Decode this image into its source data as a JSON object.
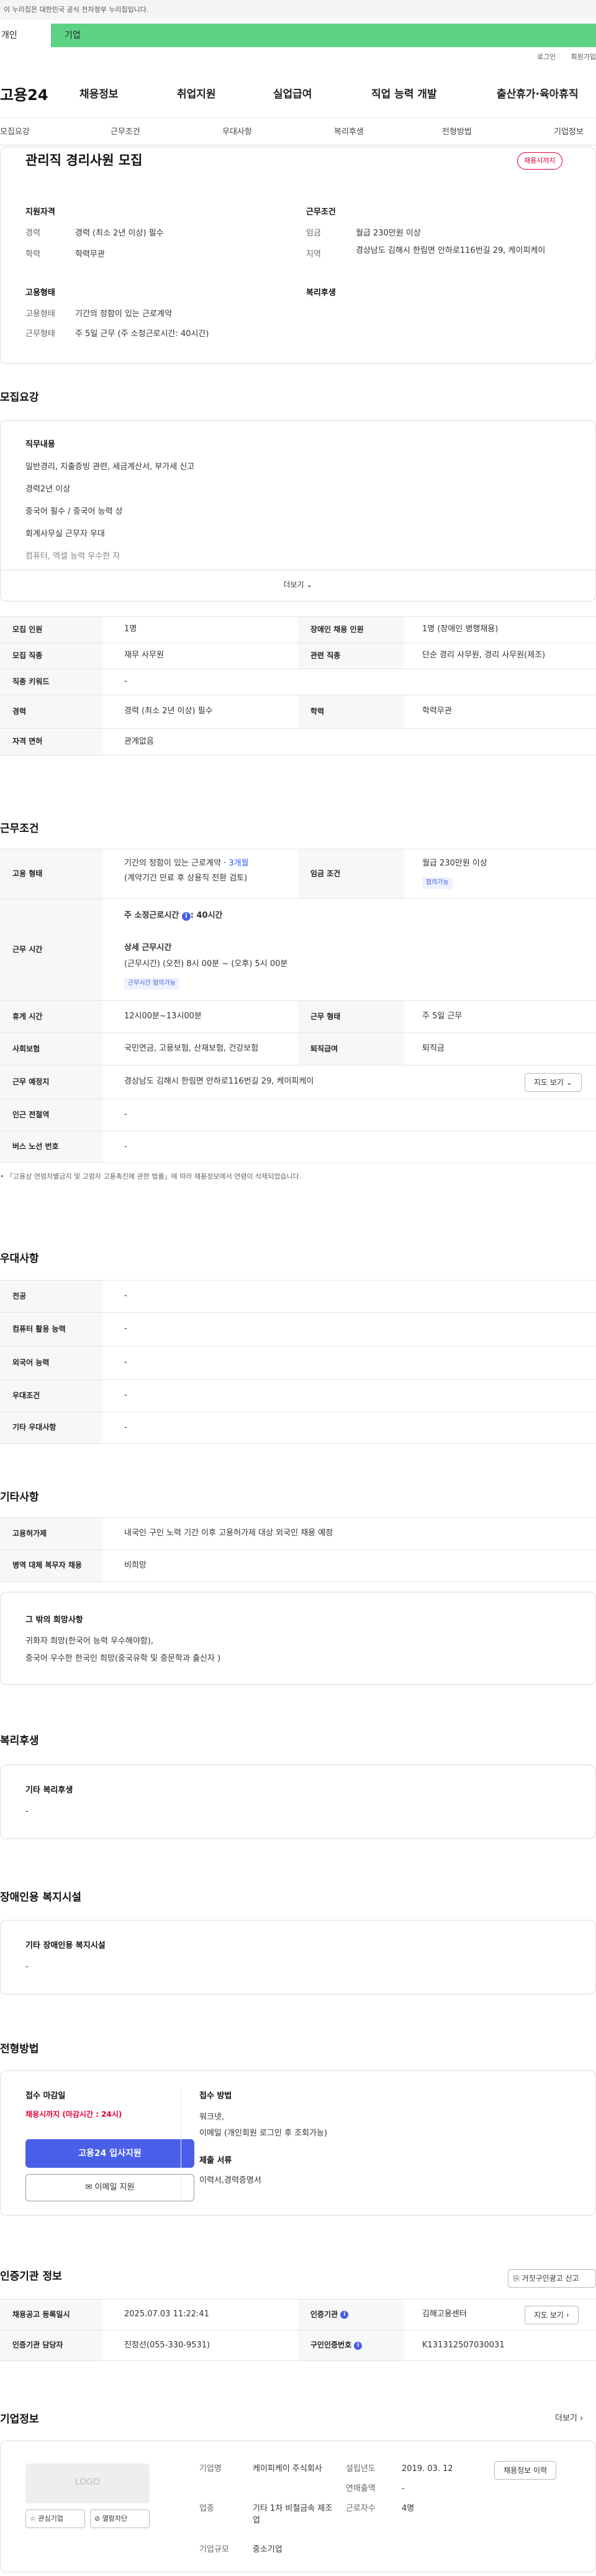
{
  "notice": "이 누리집은 대한민국 공식 전자정부 누리집입니다.",
  "tabs": {
    "individual": "개인",
    "business": "기업"
  },
  "util": {
    "login": "로그인",
    "signup": "회원가입"
  },
  "gnb": {
    "logo": "고용24",
    "items": [
      "채용정보",
      "취업지원",
      "실업급여",
      "직업 능력 개발",
      "출산휴가·육아휴직"
    ]
  },
  "subnav": [
    "모집요강",
    "근무조건",
    "우대사항",
    "복리후생",
    "전형방법",
    "기업정보"
  ],
  "job": {
    "title": "관리직 경리사원 모집",
    "status": "채용시까지",
    "qual_h": "지원자격",
    "qual": [
      [
        "경력",
        "경력 (최소 2년 이상) 필수"
      ],
      [
        "학력",
        "학력무관"
      ]
    ],
    "cond_h": "근무조건",
    "cond": [
      [
        "임금",
        "월급 230만원 이상"
      ],
      [
        "지역",
        "경상남도 김해시 한림면 안하로116번길 29, 케이피케이"
      ]
    ],
    "emp_h": "고용형태",
    "emp": [
      [
        "고용형태",
        "기간의 정함이 있는 근로계약"
      ],
      [
        "근무형태",
        "주 5일 근무 (주 소정근로시간: 40시간)"
      ]
    ],
    "welfare_h": "복리후생"
  },
  "recruit": {
    "heading": "모집요강",
    "duty_h": "직무내용",
    "duties": [
      "일반경리, 지출증빙 관련, 세금계산서, 부가세 신고",
      "경력2년 이상",
      "중국어 필수 / 중국어 능력 상",
      "회계사무실 근무자 우대",
      "컴퓨터, 엑셀 능력 우수한 자"
    ],
    "more": "더보기",
    "rows": [
      [
        "모집 인원",
        "1명",
        "장애인 채용 인원",
        "1명 (장애인 병행채용)"
      ],
      [
        "모집 직종",
        "재무 사무원",
        "관련 직종",
        "단순 경리 사무원, 경리 사무원(제조)"
      ],
      [
        "직종 키워드",
        "-",
        "",
        ""
      ],
      [
        "경력",
        "경력 (최소 2년 이상) 필수",
        "학력",
        "학력무관"
      ],
      [
        "자격 면허",
        "관계없음",
        "",
        ""
      ]
    ]
  },
  "work": {
    "heading": "근무조건",
    "emp_lab": "고용 형태",
    "emp_v1": "기간의 정함이 있는 근로계약 · ",
    "emp_v1b": "3개월",
    "emp_v2": "(계약기간 만료 후 상용직 전환 검토)",
    "wage_lab": "임금 조건",
    "wage_v": "월급 230만원 이상",
    "wage_chip": "협의가능",
    "time_lab": "근무 시간",
    "time_sum": "주 소정근로시간 ",
    "time_sum_b": ": 40시간",
    "time_det_h": "상세 근무시간",
    "time_det": "(근무시간) (오전) 8시 00분 ~ (오후) 5시 00분",
    "time_chip": "근무시간 협의가능",
    "rest_lab": "휴게 시간",
    "rest_v": "12시00분~13시00분",
    "type_lab": "근무 형태",
    "type_v": "주 5일 근무",
    "ins_lab": "사회보험",
    "ins_v": "국민연금, 고용보험, 산재보험, 건강보험",
    "ret_lab": "퇴직급여",
    "ret_v": "퇴직금",
    "loc_lab": "근무 예정지",
    "loc_v": "경상남도 김해시 한림면 안하로116번길 29, 케이피케이",
    "map_btn": "지도 보기",
    "sub_lab": "인근 전철역",
    "sub_v": "-",
    "bus_lab": "버스 노선 번호",
    "bus_v": "-",
    "footnote": "「고용상 연령차별금지 및 고령자 고용촉진에 관한 법률」에 따라 채용정보에서 연령이 삭제되었습니다."
  },
  "pref": {
    "heading": "우대사항",
    "rows": [
      [
        "전공",
        "-"
      ],
      [
        "컴퓨터 활용 능력",
        "-"
      ],
      [
        "외국어 능력",
        "-"
      ],
      [
        "우대조건",
        "-"
      ],
      [
        "기타 우대사항",
        "-"
      ]
    ]
  },
  "etc": {
    "heading": "기타사항",
    "rows": [
      [
        "고용허가제",
        "내국인 구인 노력 기간 이후 고용허가제 대상 외국인 채용 예정"
      ],
      [
        "병역 대체 복무자 채용",
        "비희망"
      ]
    ],
    "wish_h": "그 밖의 희망사항",
    "wish": [
      "귀화자 희망(한국어 능력 우수해야함),",
      "중국어 우수한 한국인 희망(중국유학 및 중문학과 출신자 )"
    ]
  },
  "benefit": {
    "heading": "복리후생",
    "sub": "기타 복리후생",
    "v": "-"
  },
  "disab": {
    "heading": "장애인용 복지시설",
    "sub": "기타 장애인용 복지시설",
    "v": "-"
  },
  "select": {
    "heading": "전형방법",
    "deadline_h": "접수 마감일",
    "deadline": "채용시까지 (마감시간 : 24시)",
    "apply": "고용24 입사지원",
    "email": "이메일 지원",
    "method_h": "접수 방법",
    "method": [
      "워크넷,",
      "이메일 (개인회원 로그인 후 조회가능)"
    ],
    "docs_h": "제출 서류",
    "docs": "이력서,경력증명서"
  },
  "cert": {
    "heading": "인증기관 정보",
    "report": "거짓구인광고 신고",
    "rows": [
      [
        "채용공고 등록일시",
        "2025.07.03 11:22:41",
        "인증기관",
        "김해고용센터"
      ],
      [
        "인증기관 담당자",
        "진정선(055-330-9531)",
        "구인인증번호",
        "K131312507030031"
      ]
    ],
    "map_btn": "지도 보기"
  },
  "company": {
    "heading": "기업정보",
    "more": "더보기",
    "logo": "LOGO",
    "fav": "관심기업",
    "block": "열람차단",
    "name_k": "기업명",
    "name_v": "케이피케이 주식회사",
    "ind_k": "업종",
    "ind_v": "기타 1차 비철금속 제조업",
    "size_k": "기업규모",
    "size_v": "중소기업",
    "est_k": "설립년도",
    "est_v": "2019. 03. 12",
    "sales_k": "연매출액",
    "sales_v": "-",
    "emp_k": "근로자수",
    "emp_v": "4명",
    "jobs_btn": "채용정보 이력"
  },
  "colors": {
    "green": "#5cd285",
    "red": "#e4003a",
    "blue": "#4a5fe8"
  }
}
